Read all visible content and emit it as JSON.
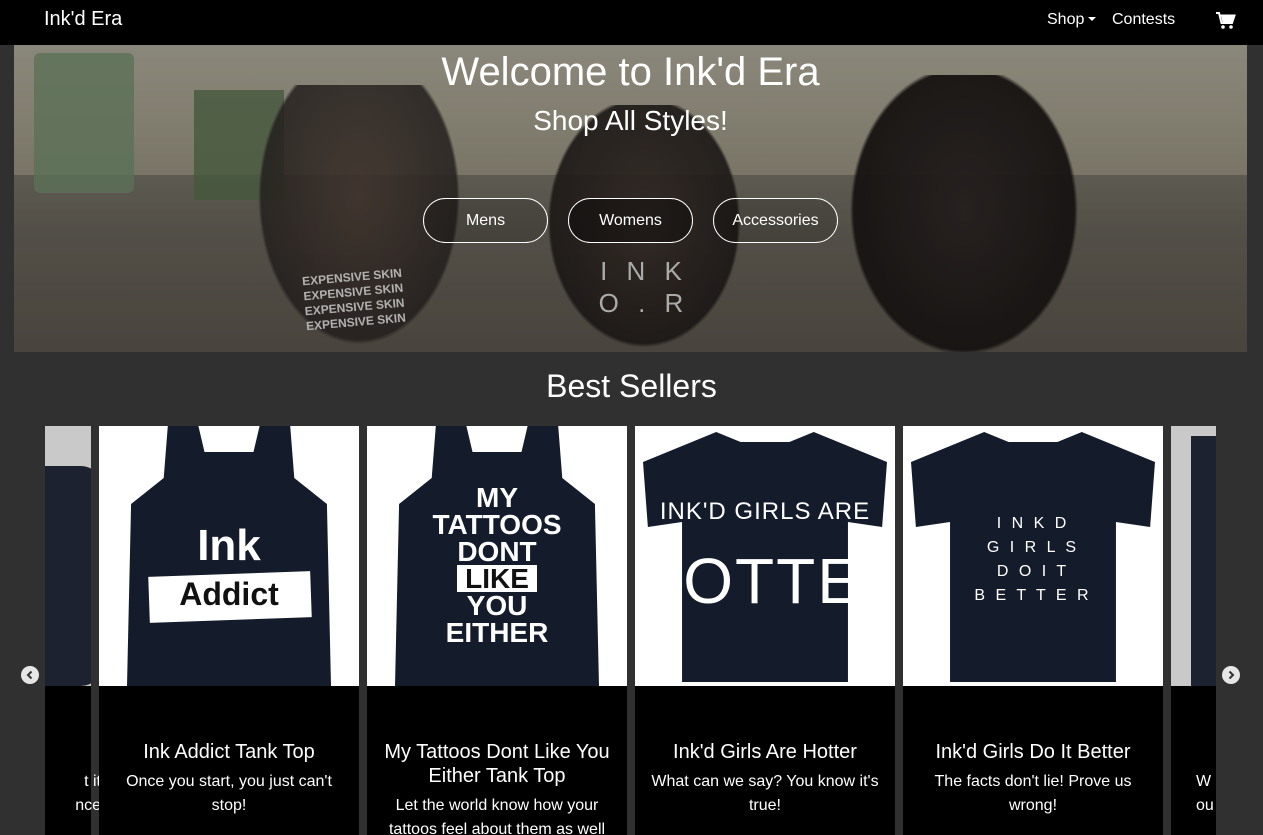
{
  "navbar": {
    "brand": "Ink'd Era",
    "shop_label": "Shop",
    "contests_label": "Contests"
  },
  "hero": {
    "title": "Welcome to Ink'd Era",
    "subtitle": "Shop All Styles!",
    "buttons": [
      "Mens",
      "Womens",
      "Accessories"
    ],
    "photo_text": {
      "left_shirt": [
        "EXPENSIVE SKIN",
        "EXPENSIVE SKIN",
        "EXPENSIVE SKIN",
        "EXPENSIVE SKIN"
      ],
      "middle_shirt": [
        "I N K",
        "O . R"
      ]
    }
  },
  "best_sellers": {
    "title": "Best Sellers",
    "products": [
      {
        "title": "Ink Addict Tank Top",
        "description": "Once you start, you just can't stop!",
        "image_text": [
          "Ink",
          "Addict"
        ]
      },
      {
        "title": "My Tattoos Dont Like You Either Tank Top",
        "description": "Let the world know how your tattoos feel about them as well",
        "image_text": [
          "MY",
          "TATTOOS",
          "DONT",
          "LIKE",
          "YOU",
          "EITHER"
        ]
      },
      {
        "title": "Ink'd Girls Are Hotter",
        "description": "What can we say? You know it's true!",
        "image_text": [
          "INK'D GIRLS ARE",
          "HOTTER"
        ]
      },
      {
        "title": "Ink'd Girls Do It Better",
        "description": "The facts don't lie! Prove us wrong!",
        "image_text": [
          "I N K D",
          "G I R L S",
          "D O   I T",
          "B E T T E R"
        ]
      }
    ],
    "partial_left_desc": [
      "t it",
      "nce"
    ],
    "partial_right_desc": [
      "W",
      "ou"
    ]
  },
  "colors": {
    "navbar_bg": "#000000",
    "page_bg": "#303030",
    "card_bg": "#000000"
  },
  "icons": {
    "cart": "shopping-cart-icon",
    "prev": "chevron-left-icon",
    "next": "chevron-right-icon"
  }
}
